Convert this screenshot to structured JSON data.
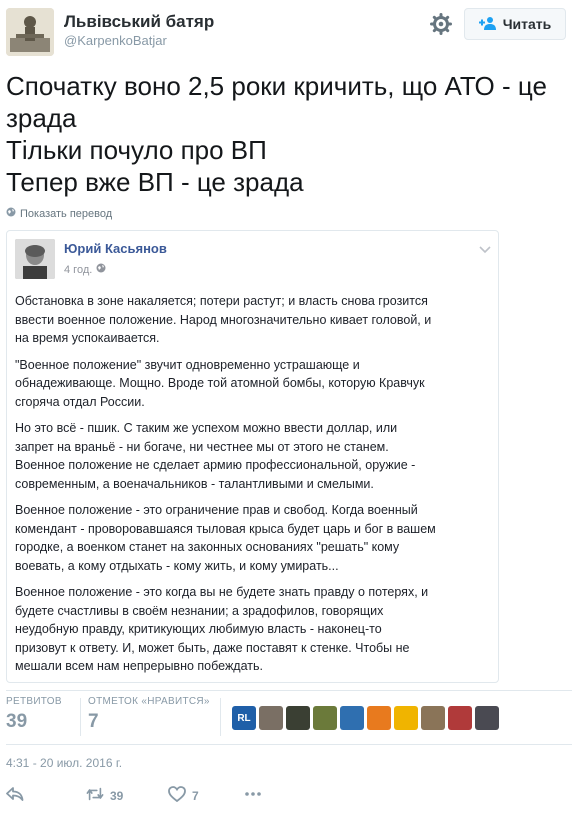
{
  "author": {
    "name": "Львівський батяр",
    "handle": "@KarpenkoBatjar"
  },
  "header": {
    "follow_label": "Читать",
    "settings_icon": "gear-icon",
    "follow_icon": "add-user-icon"
  },
  "tweet": {
    "lines": [
      "Спочатку воно 2,5 роки кричить, що АТО - це",
      "зрада",
      "Тільки почуло про ВП",
      "Тепер вже ВП - це зрада"
    ],
    "translate_label": "Показать перевод"
  },
  "embedded_post": {
    "author": "Юрий Касьянов",
    "time": "4 год.",
    "paragraphs": [
      [
        "Обстановка в зоне накаляется; потери растут; и власть снова грозится",
        "ввести военное положение. Народ многозначительно кивает головой, и",
        "на время успокаивается."
      ],
      [
        "\"Военное положение\" звучит одновременно устрашающе и",
        "обнадеживающе. Мощно. Вроде той атомной бомбы, которую Кравчук",
        "сгоряча отдал России."
      ],
      [
        "Но это всё - пшик. С таким же успехом можно ввести доллар, или",
        "запрет на враньё - ни богаче, ни честнее мы от этого не станем.",
        "Военное положение не сделает армию профессиональной, оружие -",
        "современным, а военачальников - талантливыми и смелыми."
      ],
      [
        "Военное положение - это ограничение прав и свобод. Когда военный",
        "комендант - проворовавшаяся тыловая крыса будет царь и бог в вашем",
        "городке, а военком станет на законных основаниях \"решать\" кому",
        "воевать, а кому отдыхать - кому жить, и кому умирать..."
      ],
      [
        "Военное положение - это когда вы не будете знать правду о потерях, и",
        "будете счастливы в своём незнании; а зрадофилов, говорящих",
        "неудобную правду, критикующих любимую власть - наконец-то",
        "призовут к ответу. И, может быть, даже поставят к стенке. Чтобы не",
        "мешали всем нам непрерывно побеждать."
      ]
    ]
  },
  "stats": {
    "retweets_label": "РЕТВИТОВ",
    "retweets_value": "39",
    "likes_label": "ОТМЕТОК «НРАВИТСЯ»",
    "likes_value": "7",
    "liker_avatars": [
      {
        "text": "RL",
        "color": "#1f5fa8"
      },
      {
        "text": "",
        "color": "#7a6f64"
      },
      {
        "text": "",
        "color": "#3a3f33"
      },
      {
        "text": "",
        "color": "#6b7a3a"
      },
      {
        "text": "",
        "color": "#2f6fb0"
      },
      {
        "text": "",
        "color": "#e87a1e"
      },
      {
        "text": "",
        "color": "#f0b400"
      },
      {
        "text": "",
        "color": "#8a7458"
      },
      {
        "text": "",
        "color": "#b03a3a"
      },
      {
        "text": "",
        "color": "#4a4a52"
      }
    ]
  },
  "timestamp": "4:31 - 20 июл. 2016 г.",
  "actions": {
    "reply_icon": "reply-icon",
    "retweet_count": "39",
    "like_count": "7",
    "more_icon": "more-icon"
  }
}
